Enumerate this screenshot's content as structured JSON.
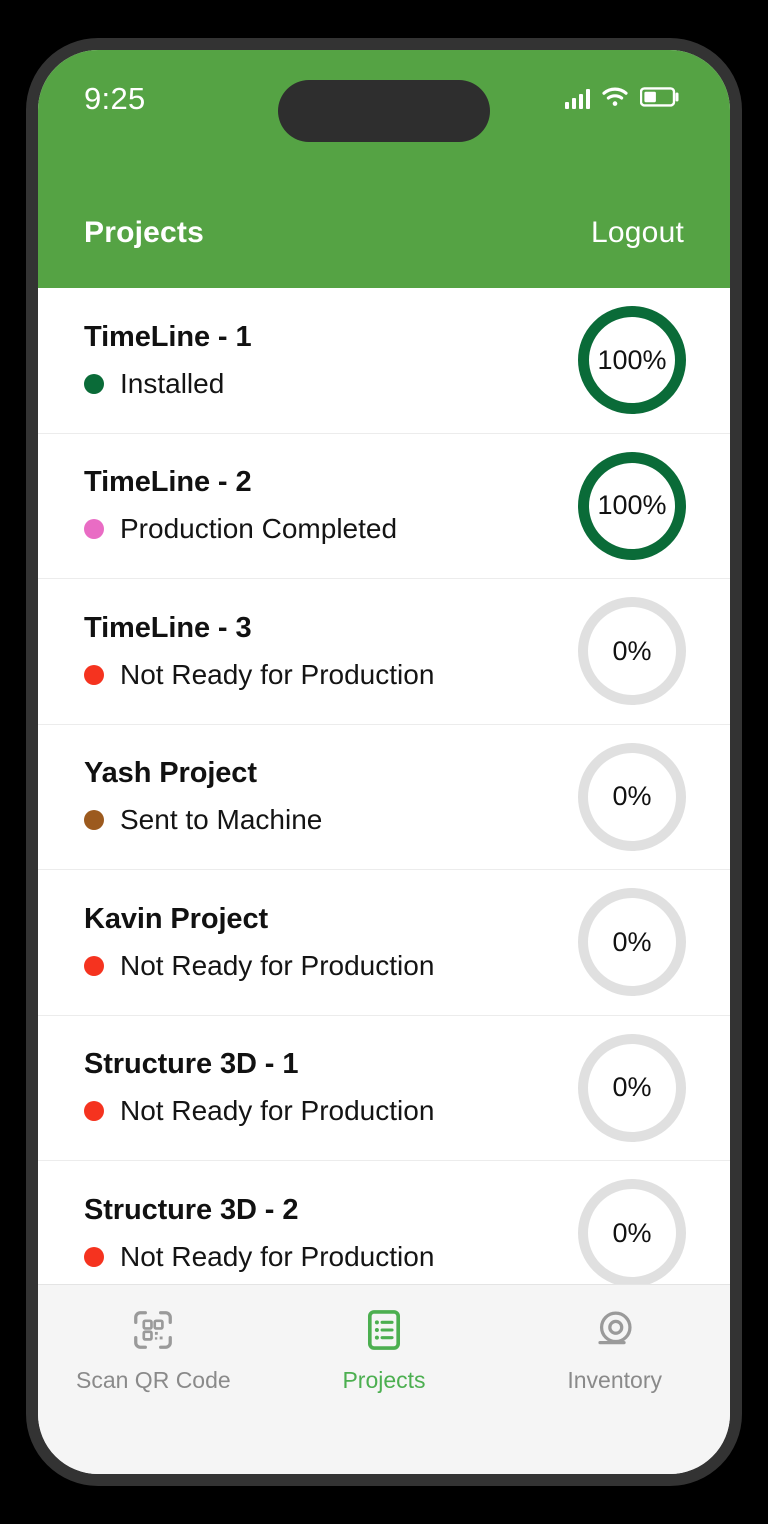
{
  "status_bar": {
    "time": "9:25",
    "signal_icon": "cellular-signal-icon",
    "wifi_icon": "wifi-icon",
    "battery_icon": "battery-icon",
    "battery_level": 40
  },
  "header": {
    "title": "Projects",
    "logout_label": "Logout",
    "background_color": "#55a344"
  },
  "colors": {
    "ring_complete": "#0a6b38",
    "ring_empty": "#e0e0e0",
    "status_installed": "#0a6b38",
    "status_production_completed": "#e96cc4",
    "status_not_ready": "#f5331f",
    "status_sent_to_machine": "#9c5a1e",
    "tab_active": "#4caf50",
    "tab_inactive": "#8a8a8a"
  },
  "projects": [
    {
      "name": "TimeLine - 1",
      "status": "Installed",
      "status_color": "#0a6b38",
      "progress": "100%",
      "progress_value": 100,
      "ring_color": "#0a6b38"
    },
    {
      "name": "TimeLine - 2",
      "status": "Production Completed",
      "status_color": "#e96cc4",
      "progress": "100%",
      "progress_value": 100,
      "ring_color": "#0a6b38"
    },
    {
      "name": "TimeLine - 3",
      "status": "Not Ready for Production",
      "status_color": "#f5331f",
      "progress": "0%",
      "progress_value": 0,
      "ring_color": "#e0e0e0"
    },
    {
      "name": "Yash Project",
      "status": "Sent to Machine",
      "status_color": "#9c5a1e",
      "progress": "0%",
      "progress_value": 0,
      "ring_color": "#e0e0e0"
    },
    {
      "name": "Kavin Project",
      "status": "Not Ready for Production",
      "status_color": "#f5331f",
      "progress": "0%",
      "progress_value": 0,
      "ring_color": "#e0e0e0"
    },
    {
      "name": "Structure 3D - 1",
      "status": "Not Ready for Production",
      "status_color": "#f5331f",
      "progress": "0%",
      "progress_value": 0,
      "ring_color": "#e0e0e0"
    },
    {
      "name": "Structure 3D - 2",
      "status": "Not Ready for Production",
      "status_color": "#f5331f",
      "progress": "0%",
      "progress_value": 0,
      "ring_color": "#e0e0e0"
    }
  ],
  "tab_bar": {
    "items": [
      {
        "label": "Scan QR Code",
        "icon": "qr-code-scan-icon",
        "active": false
      },
      {
        "label": "Projects",
        "icon": "list-document-icon",
        "active": true
      },
      {
        "label": "Inventory",
        "icon": "tape-roll-icon",
        "active": false
      }
    ]
  }
}
